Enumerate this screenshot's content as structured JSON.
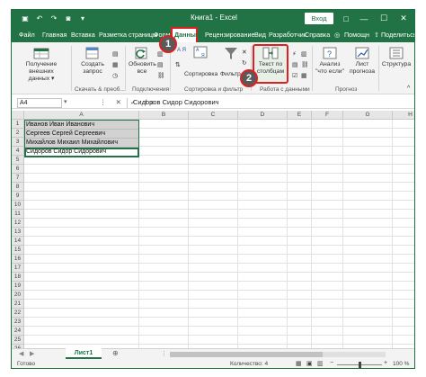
{
  "titlebar": {
    "doc_title": "Книга1 - Excel",
    "login_label": "Вход",
    "restore_icon": "□",
    "minimize_icon": "—",
    "maximize_icon": "☐",
    "close_icon": "✕"
  },
  "tabs": [
    {
      "label": "Файл"
    },
    {
      "label": "Главная"
    },
    {
      "label": "Вставка"
    },
    {
      "label": "Разметка страницы"
    },
    {
      "label": "Форм"
    },
    {
      "label": "Данные"
    },
    {
      "label": "Рецензирование"
    },
    {
      "label": "Вид"
    },
    {
      "label": "Разработчик"
    },
    {
      "label": "Справка"
    },
    {
      "label": "Помощн"
    },
    {
      "label": "Поделиться"
    }
  ],
  "ribbon": {
    "get_data": "Получение внешних данных",
    "get_data_arrow": "▾",
    "create_query": "Создать запрос",
    "create_query_group": "Скачать & преоб...",
    "refresh_all": "Обновить все",
    "connections_group": "Подключения",
    "sort": "Сортировка",
    "filter": "Фильтр",
    "sort_filter_group": "Сортировка и фильтр",
    "text_to_columns": "Текст по столбцам",
    "data_tools_group": "Работа с данными",
    "what_if": "Анализ \"что если\"",
    "forecast_sheet": "Лист прогноза",
    "forecast_group": "Прогноз",
    "outline": "Структура",
    "sort_az": "А Я",
    "collapse_icon": "^"
  },
  "badges": {
    "one": "1",
    "two": "2"
  },
  "formula_bar": {
    "name_box": "A4",
    "fx": "⋮ ✕ ✓ fx",
    "formula": "Сидоров Сидор Сидорович"
  },
  "grid": {
    "columns": [
      "A",
      "B",
      "C",
      "D",
      "E",
      "F",
      "G",
      "H"
    ],
    "rows": [
      "1",
      "2",
      "3",
      "4",
      "5",
      "6",
      "7",
      "8",
      "9",
      "10",
      "11",
      "12",
      "13",
      "14",
      "15",
      "16",
      "17",
      "18",
      "19",
      "20",
      "21",
      "22",
      "23",
      "24",
      "25",
      "26"
    ],
    "cells": [
      "Иванов Иван Иванович",
      "Сергеев Сергей Сергеевич",
      "Михайлов Михаил Михайлович",
      "Сидоров Сидор Сидорович"
    ]
  },
  "sheets": {
    "active_sheet": "Лист1",
    "add_icon": "⊕",
    "nav_prev": "◀",
    "nav_next": "▶",
    "dots": "⋮"
  },
  "status": {
    "ready": "Готово",
    "count": "Количество: 4",
    "zoom": "100 %"
  },
  "colors": {
    "brand": "#217346",
    "highlight": "#e02020"
  }
}
